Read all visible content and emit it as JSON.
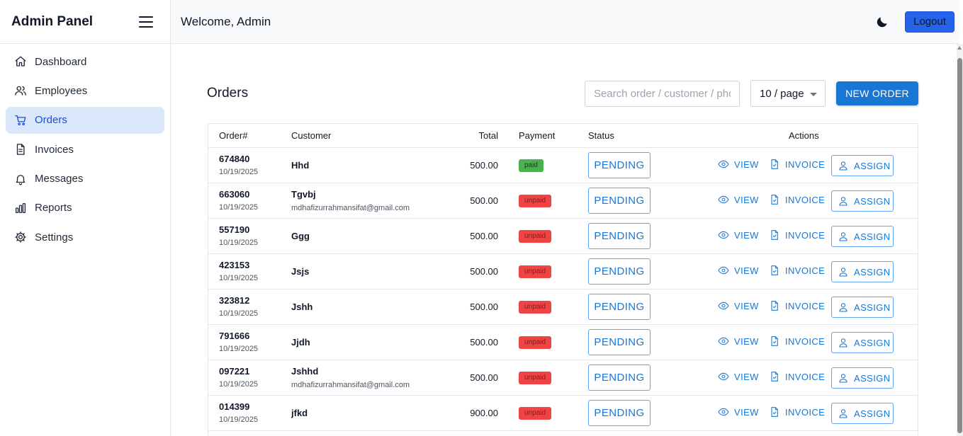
{
  "sidebar": {
    "brand": "Admin Panel",
    "items": [
      {
        "label": "Dashboard",
        "icon": "home-icon",
        "active": false
      },
      {
        "label": "Employees",
        "icon": "users-icon",
        "active": false
      },
      {
        "label": "Orders",
        "icon": "cart-icon",
        "active": true
      },
      {
        "label": "Invoices",
        "icon": "document-icon",
        "active": false
      },
      {
        "label": "Messages",
        "icon": "bell-icon",
        "active": false
      },
      {
        "label": "Reports",
        "icon": "bar-chart-icon",
        "active": false
      },
      {
        "label": "Settings",
        "icon": "gear-icon",
        "active": false
      }
    ]
  },
  "topbar": {
    "welcome": "Welcome, Admin",
    "theme_icon": "moon-icon",
    "logout_label": "Logout"
  },
  "orders": {
    "title": "Orders",
    "search_placeholder": "Search order / customer / phone",
    "per_page": "10 / page",
    "new_order_label": "NEW ORDER",
    "columns": {
      "order": "Order#",
      "customer": "Customer",
      "total": "Total",
      "payment": "Payment",
      "status": "Status",
      "actions": "Actions"
    },
    "action_labels": {
      "view": "VIEW",
      "invoice": "INVOICE",
      "assign": "ASSIGN"
    },
    "rows": [
      {
        "order_no": "674840",
        "date": "10/19/2025",
        "customer": "Hhd",
        "email": "",
        "total": "500.00",
        "payment": "paid",
        "status": "PENDING"
      },
      {
        "order_no": "663060",
        "date": "10/19/2025",
        "customer": "Tgvbj",
        "email": "mdhafizurrahmansifat@gmail.com",
        "total": "500.00",
        "payment": "unpaid",
        "status": "PENDING"
      },
      {
        "order_no": "557190",
        "date": "10/19/2025",
        "customer": "Ggg",
        "email": "",
        "total": "500.00",
        "payment": "unpaid",
        "status": "PENDING"
      },
      {
        "order_no": "423153",
        "date": "10/19/2025",
        "customer": "Jsjs",
        "email": "",
        "total": "500.00",
        "payment": "unpaid",
        "status": "PENDING"
      },
      {
        "order_no": "323812",
        "date": "10/19/2025",
        "customer": "Jshh",
        "email": "",
        "total": "500.00",
        "payment": "unpaid",
        "status": "PENDING"
      },
      {
        "order_no": "791666",
        "date": "10/19/2025",
        "customer": "Jjdh",
        "email": "",
        "total": "500.00",
        "payment": "unpaid",
        "status": "PENDING"
      },
      {
        "order_no": "097221",
        "date": "10/19/2025",
        "customer": "Jshhd",
        "email": "mdhafizurrahmansifat@gmail.com",
        "total": "500.00",
        "payment": "unpaid",
        "status": "PENDING"
      },
      {
        "order_no": "014399",
        "date": "10/19/2025",
        "customer": "jfkd",
        "email": "",
        "total": "900.00",
        "payment": "unpaid",
        "status": "PENDING"
      }
    ]
  },
  "colors": {
    "accent": "#1976d2",
    "active_nav_bg": "#dbe7fb",
    "paid": "#4caf50",
    "unpaid": "#ef4444",
    "logout_bg": "#2563eb"
  }
}
